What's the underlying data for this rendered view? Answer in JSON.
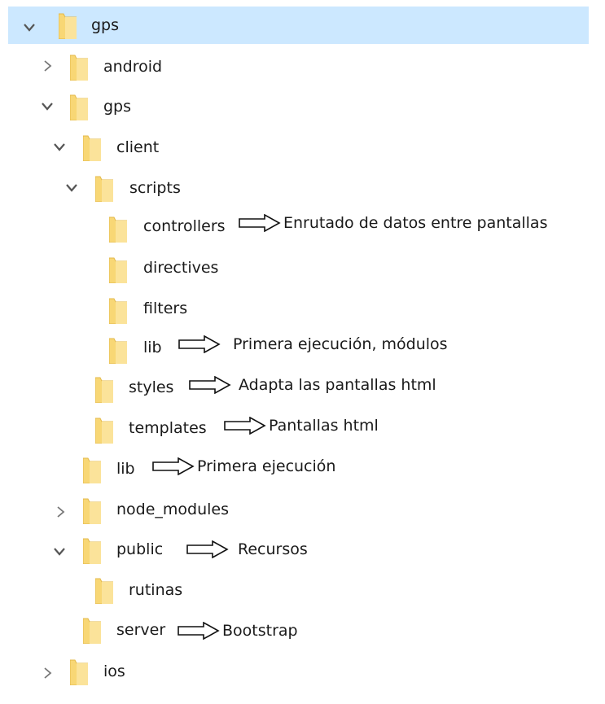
{
  "tree": {
    "rows": [
      {
        "label": "gps",
        "expanded": true,
        "selected": true
      },
      {
        "label": "android",
        "expanded": false
      },
      {
        "label": "gps",
        "expanded": true
      },
      {
        "label": "client",
        "expanded": true
      },
      {
        "label": "scripts",
        "expanded": true
      },
      {
        "label": "controllers",
        "note": "Enrutado de datos entre pantallas"
      },
      {
        "label": "directives"
      },
      {
        "label": "filters"
      },
      {
        "label": "lib",
        "note": "Primera ejecución, módulos"
      },
      {
        "label": "styles",
        "note": "Adapta las pantallas html"
      },
      {
        "label": "templates",
        "note": "Pantallas html"
      },
      {
        "label": "lib",
        "note": "Primera ejecución"
      },
      {
        "label": "node_modules",
        "expanded": false
      },
      {
        "label": "public",
        "expanded": true,
        "note": "Recursos"
      },
      {
        "label": "rutinas"
      },
      {
        "label": "server",
        "note": "Bootstrap"
      },
      {
        "label": "ios",
        "expanded": false
      }
    ]
  },
  "colors": {
    "selection": "#cce8ff",
    "folder": "#f8d775",
    "folder_edge": "#e3b94a",
    "chevron": "#555555"
  },
  "icons": {
    "expand": "chevron-down-icon",
    "collapse": "chevron-right-icon",
    "folder": "folder-icon",
    "arrow": "hollow-arrow-icon"
  }
}
